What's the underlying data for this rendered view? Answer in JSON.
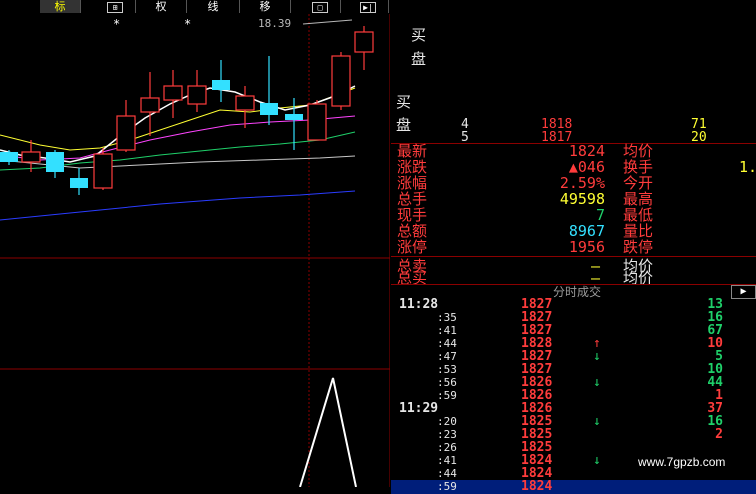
{
  "toolbar": {
    "buttons": [
      {
        "label": "标",
        "active": true
      },
      {
        "label": "⊞"
      },
      {
        "label": "权"
      },
      {
        "label": "线"
      },
      {
        "label": "移"
      },
      {
        "label": "□"
      },
      {
        "label": "▶|"
      }
    ]
  },
  "chart": {
    "price_marker": "18.39",
    "markers": [
      "*",
      "*"
    ]
  },
  "book": {
    "side_labels": [
      "买",
      "盘",
      "买",
      "盘"
    ],
    "rows": [
      {
        "level": "4",
        "price": "1818",
        "vol": "71"
      },
      {
        "level": "5",
        "price": "1817",
        "vol": "20"
      }
    ]
  },
  "stats": {
    "left": [
      {
        "label": "最新",
        "value": "1824",
        "color": "red"
      },
      {
        "label": "涨跌",
        "value": "▲046",
        "color": "red"
      },
      {
        "label": "涨幅",
        "value": "2.59%",
        "color": "red"
      },
      {
        "label": "总手",
        "value": "49598",
        "color": "yellow"
      },
      {
        "label": "现手",
        "value": "7",
        "color": "green"
      },
      {
        "label": "总额",
        "value": "8967",
        "color": "cyan"
      },
      {
        "label": "涨停",
        "value": "1956",
        "color": "red"
      }
    ],
    "right": [
      "均价",
      "换手",
      "今开",
      "最高",
      "最低",
      "量比",
      "跌停"
    ],
    "right_partial": [
      "",
      "1.",
      "",
      "",
      "",
      "",
      ""
    ]
  },
  "summary": {
    "sell_label": "总卖",
    "buy_label": "总买",
    "sell_value": "—",
    "buy_value": "—",
    "avg_label": "均价",
    "avg_label2": "均价"
  },
  "ticks": {
    "header": "分时成交",
    "rows": [
      {
        "time": "11:28",
        "price": "1827",
        "arrow": "",
        "vol": "13",
        "vcolor": "green",
        "major": true
      },
      {
        "time": ":35",
        "price": "1827",
        "arrow": "",
        "vol": "16",
        "vcolor": "green"
      },
      {
        "time": ":41",
        "price": "1827",
        "arrow": "",
        "vol": "67",
        "vcolor": "green"
      },
      {
        "time": ":44",
        "price": "1828",
        "arrow": "↑",
        "vol": "10",
        "vcolor": "red"
      },
      {
        "time": ":47",
        "price": "1827",
        "arrow": "↓",
        "vol": "5",
        "vcolor": "green"
      },
      {
        "time": ":53",
        "price": "1827",
        "arrow": "",
        "vol": "10",
        "vcolor": "green"
      },
      {
        "time": ":56",
        "price": "1826",
        "arrow": "↓",
        "vol": "44",
        "vcolor": "green"
      },
      {
        "time": ":59",
        "price": "1826",
        "arrow": "",
        "vol": "1",
        "vcolor": "red"
      },
      {
        "time": "11:29",
        "price": "1826",
        "arrow": "",
        "vol": "37",
        "vcolor": "red",
        "major": true
      },
      {
        "time": ":20",
        "price": "1825",
        "arrow": "↓",
        "vol": "16",
        "vcolor": "green"
      },
      {
        "time": ":23",
        "price": "1825",
        "arrow": "",
        "vol": "2",
        "vcolor": "red"
      },
      {
        "time": ":26",
        "price": "1825",
        "arrow": "",
        "vol": "",
        "vcolor": "red"
      },
      {
        "time": ":41",
        "price": "1824",
        "arrow": "↓",
        "vol": "",
        "vcolor": "green"
      },
      {
        "time": ":44",
        "price": "1824",
        "arrow": "",
        "vol": "",
        "vcolor": "green"
      },
      {
        "time": ":59",
        "price": "1824",
        "arrow": "",
        "vol": "",
        "vcolor": "green",
        "highlight": true
      }
    ]
  },
  "watermark": "www.7gpzb.com",
  "colors": {
    "up": "#ff3c3c",
    "down": "#33e0ff",
    "ma5": "#ffffff",
    "ma10": "#ffff33",
    "ma20": "#ff44ff",
    "ma30": "#1fd06a",
    "ma60": "#c8c8c8",
    "ma120": "#2a3cff",
    "grid": "#8b0000"
  }
}
